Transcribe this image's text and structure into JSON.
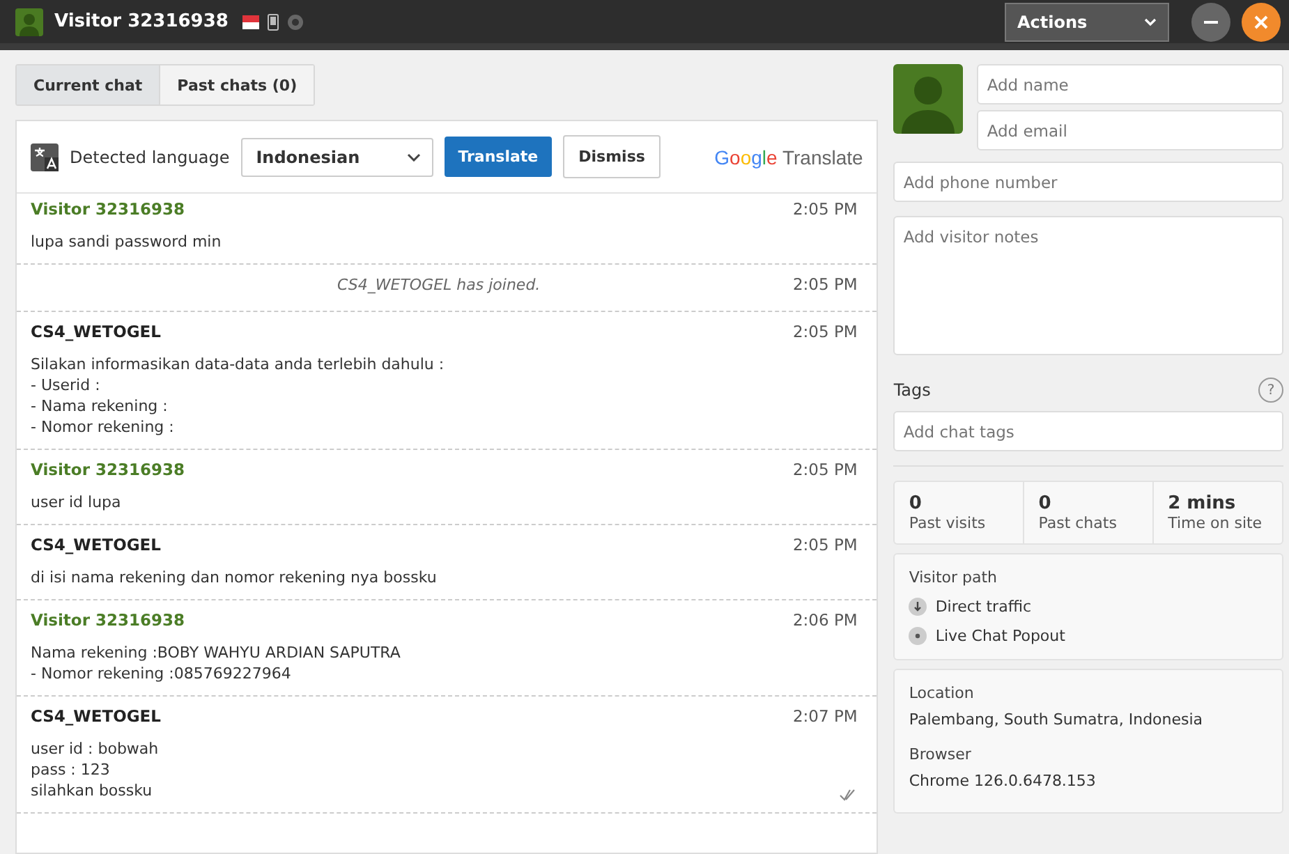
{
  "window": {
    "title": "Visitor 32316938",
    "actions": "Actions"
  },
  "tabs": [
    {
      "label": "Current chat",
      "selected": true
    },
    {
      "label": "Past chats (0)",
      "selected": false
    }
  ],
  "translate": {
    "label": "Detected language",
    "language": "Indonesian",
    "translate_button": "Translate",
    "dismiss_button": "Dismiss",
    "brand": "Google",
    "brand_suffix": "Translate"
  },
  "messages": [
    {
      "kind": "visitor",
      "author": "Visitor 32316938",
      "time": "2:05 PM",
      "lines": [
        "lupa sandi password min"
      ]
    },
    {
      "kind": "event",
      "text": "CS4_WETOGEL has joined.",
      "time": "2:05 PM"
    },
    {
      "kind": "agent",
      "author": "CS4_WETOGEL",
      "time": "2:05 PM",
      "lines": [
        "Silakan informasikan data-data anda terlebih dahulu :",
        "- Userid :",
        "- Nama rekening :",
        "- Nomor rekening :"
      ]
    },
    {
      "kind": "visitor",
      "author": "Visitor 32316938",
      "time": "2:05 PM",
      "lines": [
        "user id lupa"
      ]
    },
    {
      "kind": "agent",
      "author": "CS4_WETOGEL",
      "time": "2:05 PM",
      "lines": [
        "di isi nama rekening dan nomor rekening nya bossku"
      ]
    },
    {
      "kind": "visitor",
      "author": "Visitor 32316938",
      "time": "2:06 PM",
      "lines": [
        "Nama rekening :BOBY WAHYU ARDIAN SAPUTRA",
        "- Nomor rekening :085769227964"
      ]
    },
    {
      "kind": "agent",
      "author": "CS4_WETOGEL",
      "time": "2:07 PM",
      "lines": [
        "user id : bobwah",
        "pass : 123",
        "silahkan bossku"
      ],
      "read": true
    }
  ],
  "visitor": {
    "name_placeholder": "Add name",
    "email_placeholder": "Add email",
    "phone_placeholder": "Add phone number",
    "notes_placeholder": "Add visitor notes",
    "tags_label": "Tags",
    "tags_help": "?",
    "tags_placeholder": "Add chat tags"
  },
  "stats": [
    {
      "value": "0",
      "label": "Past visits"
    },
    {
      "value": "0",
      "label": "Past chats"
    },
    {
      "value": "2 mins",
      "label": "Time on site"
    }
  ],
  "visitor_path": {
    "title": "Visitor path",
    "items": [
      {
        "kind": "referrer",
        "label": "Direct traffic"
      },
      {
        "kind": "page",
        "label": "Live Chat Popout"
      }
    ]
  },
  "info": [
    {
      "label": "Location",
      "value": "Palembang, South Sumatra, Indonesia"
    },
    {
      "label": "Browser",
      "value": "Chrome 126.0.6478.153"
    }
  ]
}
